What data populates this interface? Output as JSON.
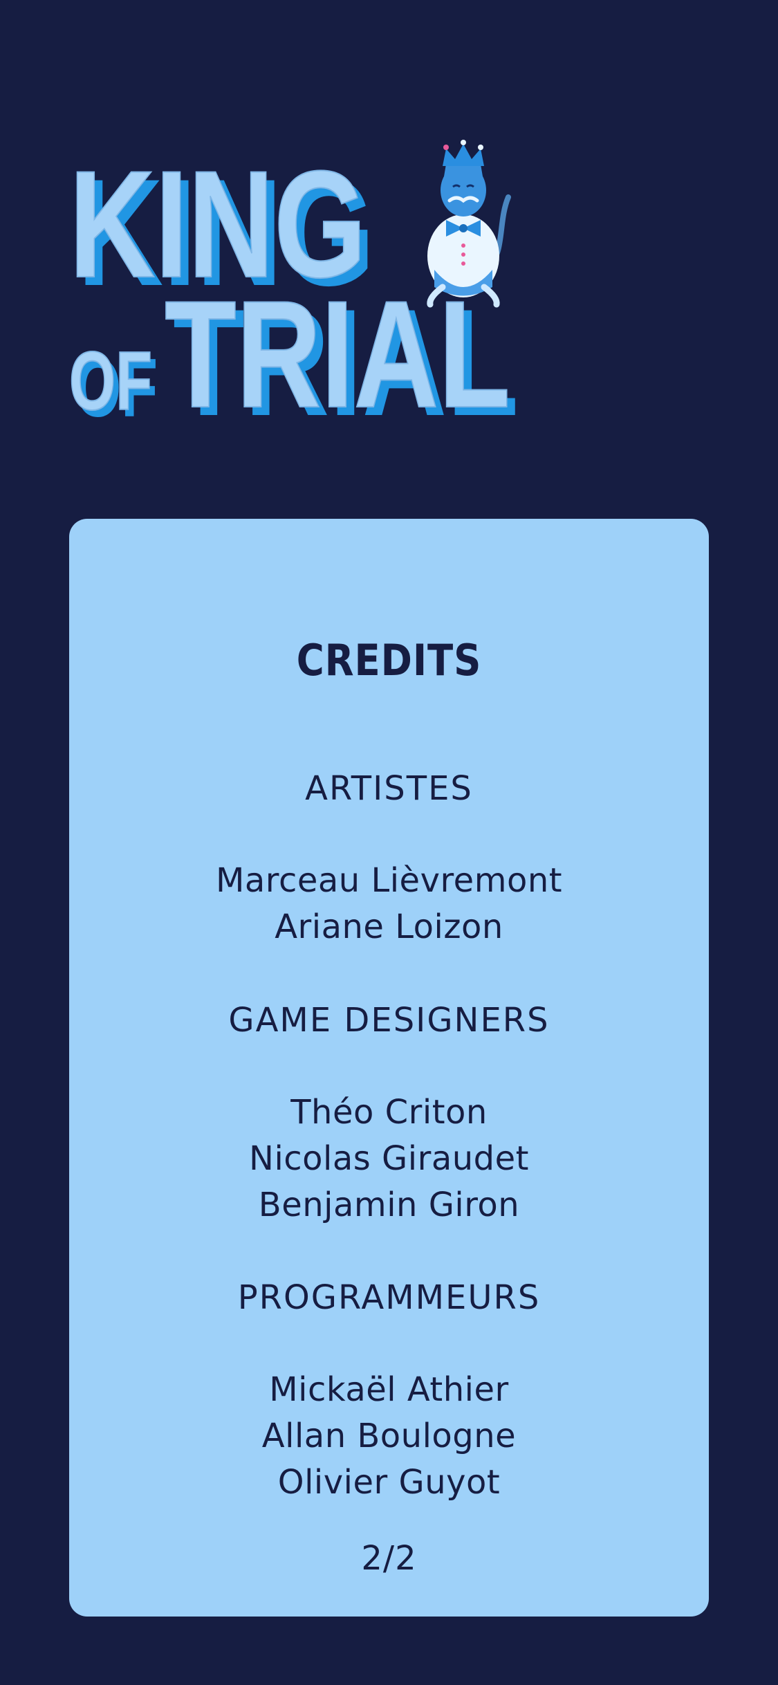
{
  "logo": {
    "line1": "KING",
    "line2_small": "OF",
    "line2_big": "TRIAL"
  },
  "credits": {
    "title": "CREDITS",
    "sections": [
      {
        "heading": "ARTISTES",
        "names": [
          "Marceau Lièvremont",
          "Ariane Loizon"
        ]
      },
      {
        "heading": "GAME DESIGNERS",
        "names": [
          "Théo Criton",
          "Nicolas Giraudet",
          "Benjamin Giron"
        ]
      },
      {
        "heading": "PROGRAMMEURS",
        "names": [
          "Mickaël Athier",
          "Allan Boulogne",
          "Olivier Guyot"
        ]
      }
    ],
    "page_indicator": "2/2"
  },
  "colors": {
    "background": "#161d42",
    "card": "#9ed1f9",
    "text": "#161d42",
    "logo_fill": "#a7d3f8",
    "logo_shadow": "#2196e3"
  }
}
